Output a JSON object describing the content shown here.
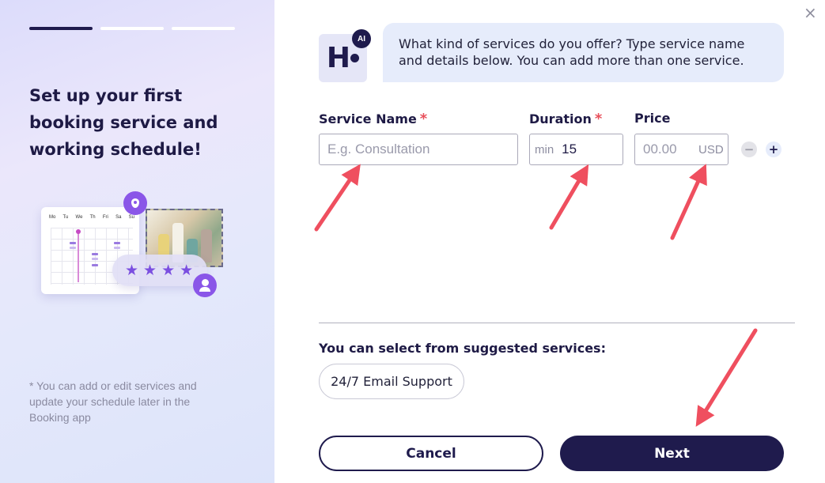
{
  "steps": [
    {
      "active": true
    },
    {
      "active": false
    },
    {
      "active": false
    }
  ],
  "left": {
    "title": "Set up your first booking service and working schedule!",
    "note": "* You can add or edit services and update your schedule later in the Booking app",
    "calendar_days": [
      "Mo",
      "Tu",
      "We",
      "Th",
      "Fri",
      "Sa",
      "Su"
    ],
    "rating_stars": 4
  },
  "close_symbol": "×",
  "assistant": {
    "logo_letter": "H",
    "badge": "AI",
    "message": "What kind of services do you offer? Type service name and details below. You can add more than one service."
  },
  "form": {
    "service_name": {
      "label": "Service Name",
      "required": "*",
      "placeholder": "E.g. Consultation",
      "value": ""
    },
    "duration": {
      "label": "Duration",
      "required": "*",
      "unit": "min",
      "value": "15"
    },
    "price": {
      "label": "Price",
      "placeholder": "00.00",
      "currency": "USD",
      "value": ""
    },
    "remove_symbol": "−",
    "add_symbol": "+"
  },
  "suggestions": {
    "title": "You can select from suggested services:",
    "items": [
      "24/7 Email Support"
    ]
  },
  "buttons": {
    "cancel": "Cancel",
    "next": "Next"
  },
  "colors": {
    "primary": "#1f1b4d",
    "accent": "#8a56e8",
    "required": "#e8505b",
    "annotation": "#ef4f5f"
  },
  "icons": [
    "close-icon",
    "location-pin-icon",
    "star-icon",
    "user-icon",
    "minus-icon",
    "plus-icon",
    "annotation-arrow"
  ]
}
